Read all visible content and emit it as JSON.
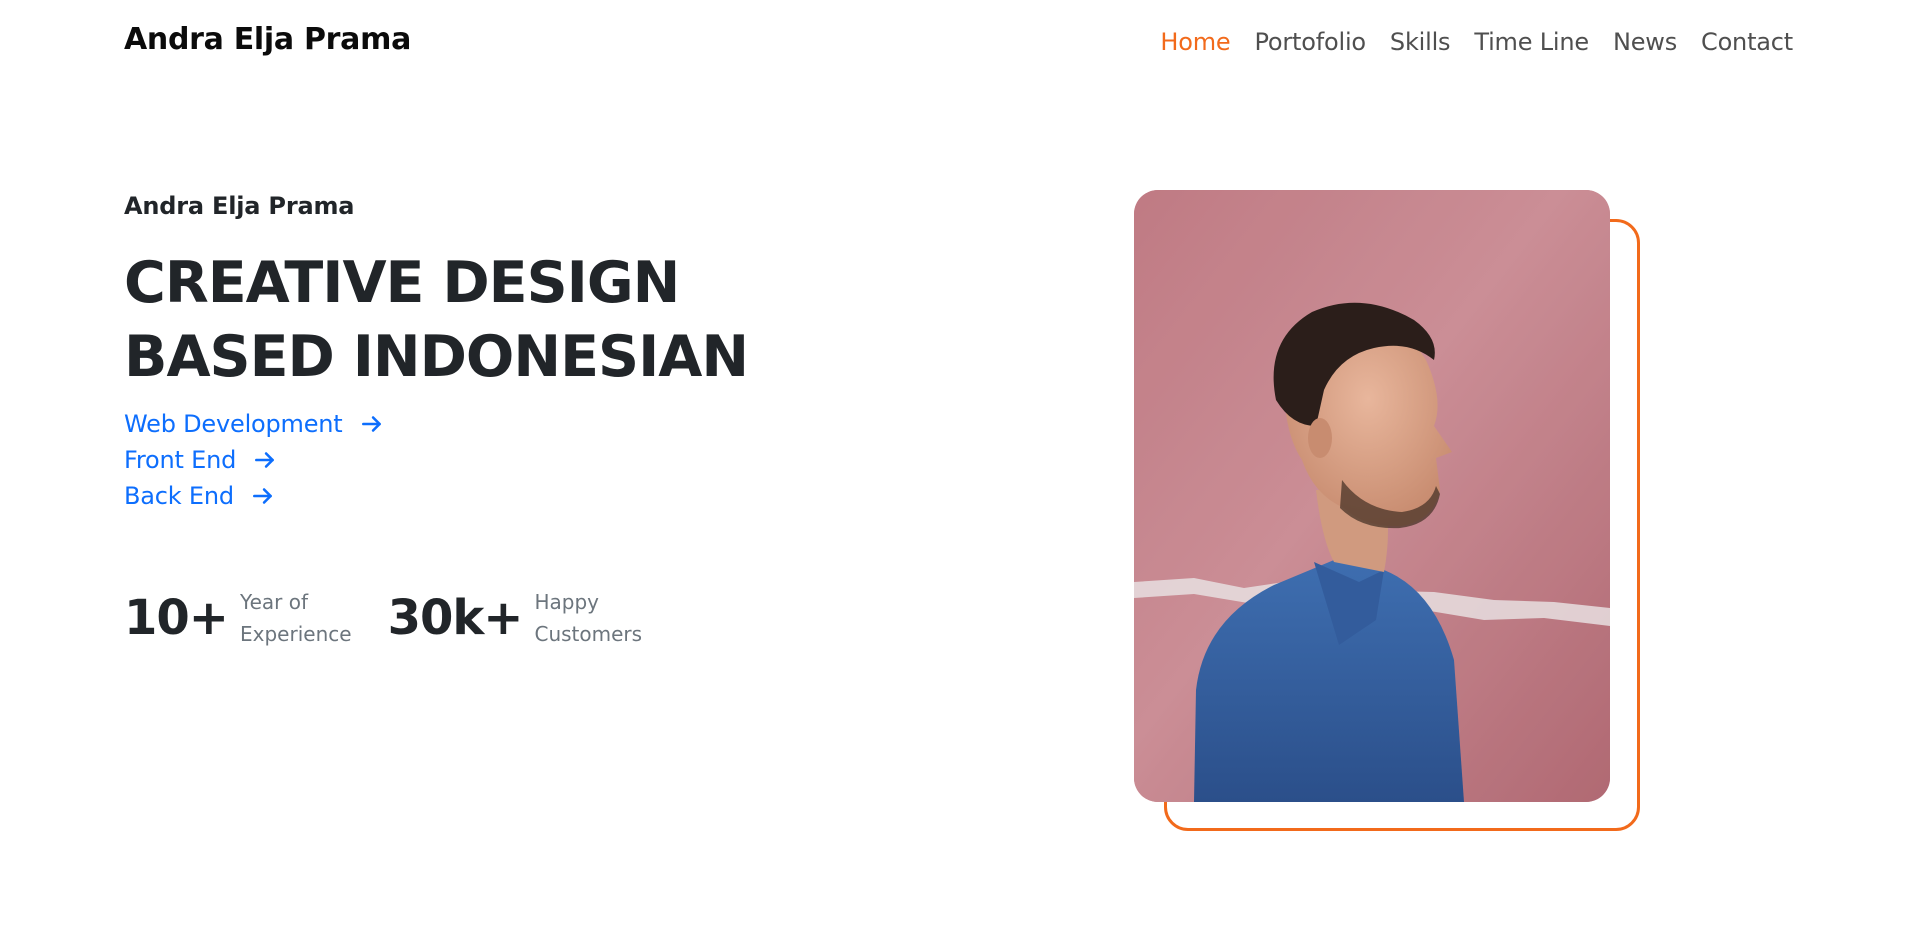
{
  "header": {
    "brand": "Andra Elja Prama",
    "nav": [
      {
        "label": "Home",
        "active": true
      },
      {
        "label": "Portofolio",
        "active": false
      },
      {
        "label": "Skills",
        "active": false
      },
      {
        "label": "Time Line",
        "active": false
      },
      {
        "label": "News",
        "active": false
      },
      {
        "label": "Contact",
        "active": false
      }
    ]
  },
  "hero": {
    "name": "Andra Elja Prama",
    "title_line1": "CREATIVE DESIGN",
    "title_line2": "BASED INDONESIAN",
    "services": [
      {
        "label": "Web Development",
        "icon": "arrow-right-icon"
      },
      {
        "label": "Front End",
        "icon": "arrow-right-icon"
      },
      {
        "label": "Back End",
        "icon": "arrow-right-icon"
      }
    ],
    "stats": [
      {
        "number": "10+",
        "label_line1": "Year of",
        "label_line2": "Experience"
      },
      {
        "number": "30k+",
        "label_line1": "Happy",
        "label_line2": "Customers"
      }
    ],
    "photo": {
      "subject": "portrait-photo"
    }
  },
  "colors": {
    "accent": "#f26a1b",
    "link": "#0d6efd",
    "heading": "#212529",
    "muted": "#6c757d",
    "nav_text": "#4f4f4f",
    "background": "#ffffff"
  }
}
